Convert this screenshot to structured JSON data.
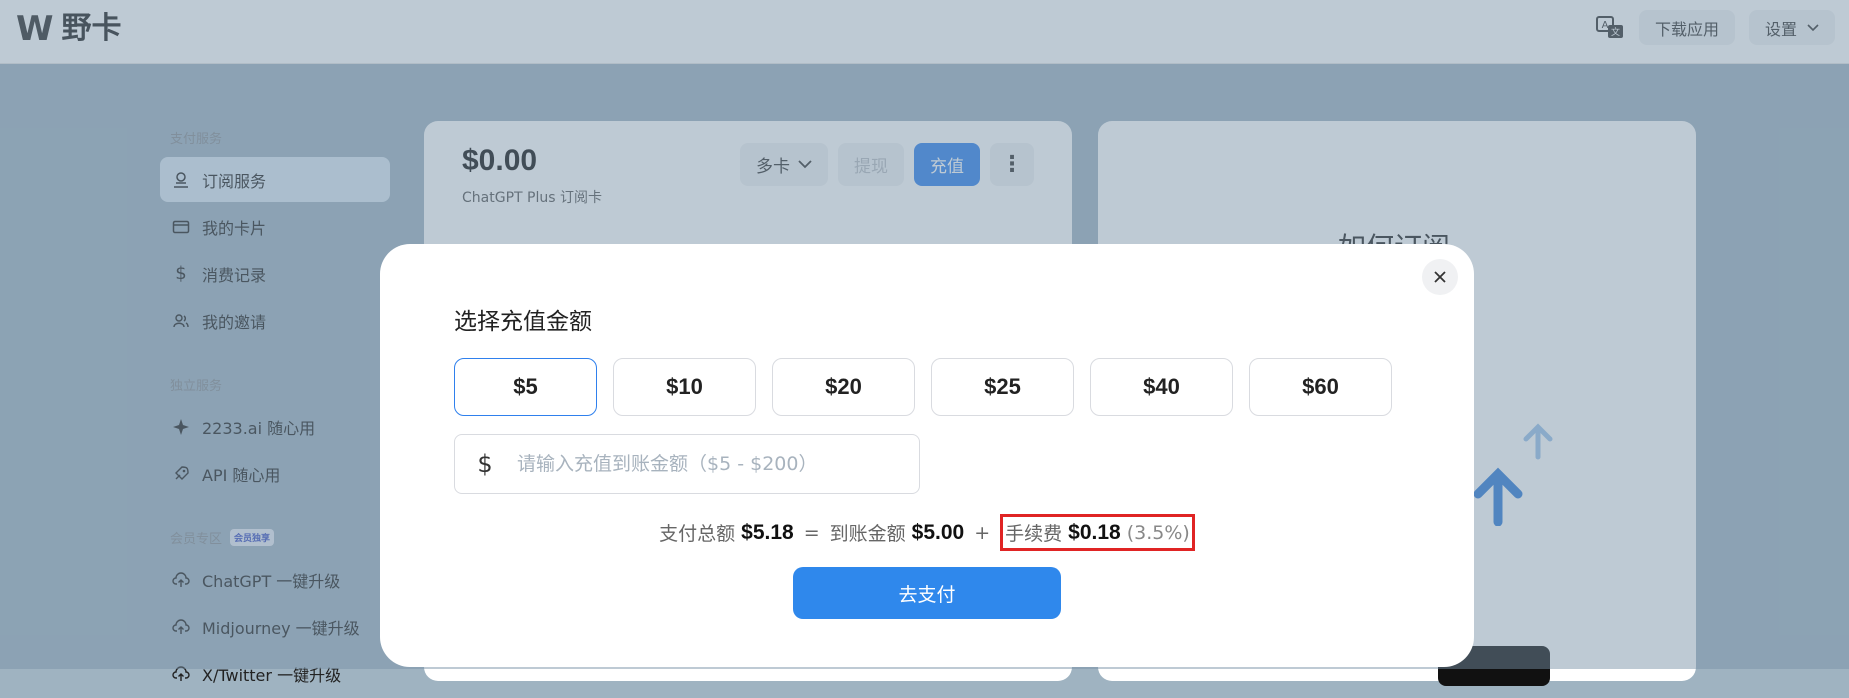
{
  "app": {
    "logo_mark": "W",
    "name": "野卡"
  },
  "topbar": {
    "download_label": "下载应用",
    "settings_label": "设置"
  },
  "sidebar": {
    "section_payment": "支付服务",
    "items_payment": [
      {
        "label": "订阅服务",
        "icon": "subscription-icon",
        "active": true
      },
      {
        "label": "我的卡片",
        "icon": "card-icon"
      },
      {
        "label": "消费记录",
        "icon": "dollar-icon"
      },
      {
        "label": "我的邀请",
        "icon": "users-icon"
      }
    ],
    "section_independent": "独立服务",
    "items_independent": [
      {
        "label": "2233.ai 随心用",
        "icon": "sparkle-icon"
      },
      {
        "label": "API 随心用",
        "icon": "rocket-icon"
      }
    ],
    "section_member": "会员专区",
    "member_badge": "会员独享",
    "items_member": [
      {
        "label": "ChatGPT 一键升级",
        "icon": "cloud-upload-icon"
      },
      {
        "label": "Midjourney 一键升级",
        "icon": "cloud-upload-icon"
      },
      {
        "label": "X/Twitter 一键升级",
        "icon": "cloud-upload-icon"
      }
    ]
  },
  "card": {
    "balance": "$0.00",
    "card_name": "ChatGPT Plus 订阅卡",
    "multi_card_label": "多卡",
    "withdraw_label": "提现",
    "recharge_label": "充值",
    "more_label": "⋮"
  },
  "howto": {
    "title": "如何订阅"
  },
  "modal": {
    "title": "选择充值金额",
    "amounts": [
      "$5",
      "$10",
      "$20",
      "$25",
      "$40",
      "$60"
    ],
    "selected_amount": "$5",
    "custom_currency": "$",
    "custom_placeholder": "请输入充值到账金额（$5 - $200）",
    "summary": {
      "total_label": "支付总额",
      "total_value": "$5.18",
      "equals": "=",
      "received_label": "到账金额",
      "received_value": "$5.00",
      "plus": "+",
      "fee_label": "手续费",
      "fee_value": "$0.18",
      "fee_percent": "(3.5%)"
    },
    "pay_label": "去支付"
  },
  "colors": {
    "primary": "#2f80ed",
    "highlight": "#e02424",
    "overlay": "rgba(120,145,165,0.48)"
  }
}
